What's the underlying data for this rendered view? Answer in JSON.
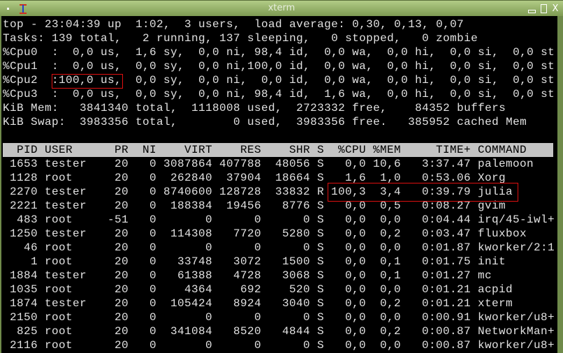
{
  "window": {
    "title": "xterm"
  },
  "summary": [
    "top - 23:04:39 up  1:02,  3 users,  load average: 0,30, 0,13, 0,07",
    "Tasks: 139 total,   2 running, 137 sleeping,   0 stopped,   0 zombie",
    "%Cpu0  :  0,0 us,  1,6 sy,  0,0 ni, 98,4 id,  0,0 wa,  0,0 hi,  0,0 si,  0,0 st",
    "%Cpu1  :  0,0 us,  0,0 sy,  0,0 ni,100,0 id,  0,0 wa,  0,0 hi,  0,0 si,  0,0 st",
    "%Cpu2  :100,0 us,  0,0 sy,  0,0 ni,  0,0 id,  0,0 wa,  0,0 hi,  0,0 si,  0,0 st",
    "%Cpu3  :  0,0 us,  0,0 sy,  0,0 ni, 98,4 id,  1,6 wa,  0,0 hi,  0,0 si,  0,0 st",
    "KiB Mem:   3841340 total,  1118008 used,  2723332 free,    84352 buffers",
    "KiB Swap:  3983356 total,        0 used,  3983356 free.   385952 cached Mem"
  ],
  "columns": [
    "PID",
    "USER",
    "PR",
    "NI",
    "VIRT",
    "RES",
    "SHR",
    "S",
    "%CPU",
    "%MEM",
    "TIME+",
    "COMMAND"
  ],
  "processes": [
    [
      "1653",
      "tester",
      "20",
      "0",
      "3087864",
      "407788",
      "48056",
      "S",
      "0,0",
      "10,6",
      "3:37.47",
      "palemoon"
    ],
    [
      "1128",
      "root",
      "20",
      "0",
      "262840",
      "37904",
      "18664",
      "S",
      "1,6",
      "1,0",
      "0:53.06",
      "Xorg"
    ],
    [
      "2270",
      "tester",
      "20",
      "0",
      "8740600",
      "128728",
      "33832",
      "R",
      "100,3",
      "3,4",
      "0:39.79",
      "julia"
    ],
    [
      "2221",
      "tester",
      "20",
      "0",
      "188384",
      "19456",
      "8776",
      "S",
      "0,0",
      "0,5",
      "0:08.27",
      "gvim"
    ],
    [
      "483",
      "root",
      "-51",
      "0",
      "0",
      "0",
      "0",
      "S",
      "0,0",
      "0,0",
      "0:04.44",
      "irq/45-iwl+"
    ],
    [
      "1250",
      "tester",
      "20",
      "0",
      "114308",
      "7720",
      "5280",
      "S",
      "0,0",
      "0,2",
      "0:03.47",
      "fluxbox"
    ],
    [
      "46",
      "root",
      "20",
      "0",
      "0",
      "0",
      "0",
      "S",
      "0,0",
      "0,0",
      "0:01.87",
      "kworker/2:1"
    ],
    [
      "1",
      "root",
      "20",
      "0",
      "33748",
      "3072",
      "1500",
      "S",
      "0,0",
      "0,1",
      "0:01.75",
      "init"
    ],
    [
      "1884",
      "tester",
      "20",
      "0",
      "61388",
      "4728",
      "3068",
      "S",
      "0,0",
      "0,1",
      "0:01.27",
      "mc"
    ],
    [
      "1035",
      "root",
      "20",
      "0",
      "4364",
      "692",
      "520",
      "S",
      "0,0",
      "0,0",
      "0:01.21",
      "acpid"
    ],
    [
      "1874",
      "tester",
      "20",
      "0",
      "105424",
      "8924",
      "3040",
      "S",
      "0,0",
      "0,2",
      "0:01.21",
      "xterm"
    ],
    [
      "2150",
      "root",
      "20",
      "0",
      "0",
      "0",
      "0",
      "S",
      "0,0",
      "0,0",
      "0:00.91",
      "kworker/u8+"
    ],
    [
      "825",
      "root",
      "20",
      "0",
      "341084",
      "8520",
      "4844",
      "S",
      "0,0",
      "0,2",
      "0:00.87",
      "NetworkMan+"
    ],
    [
      "2116",
      "root",
      "20",
      "0",
      "0",
      "0",
      "0",
      "S",
      "0,0",
      "0,0",
      "0:00.87",
      "kworker/u8+"
    ]
  ],
  "colors": {
    "highlight": "#e01010",
    "header_bg": "#c4c4c4"
  }
}
